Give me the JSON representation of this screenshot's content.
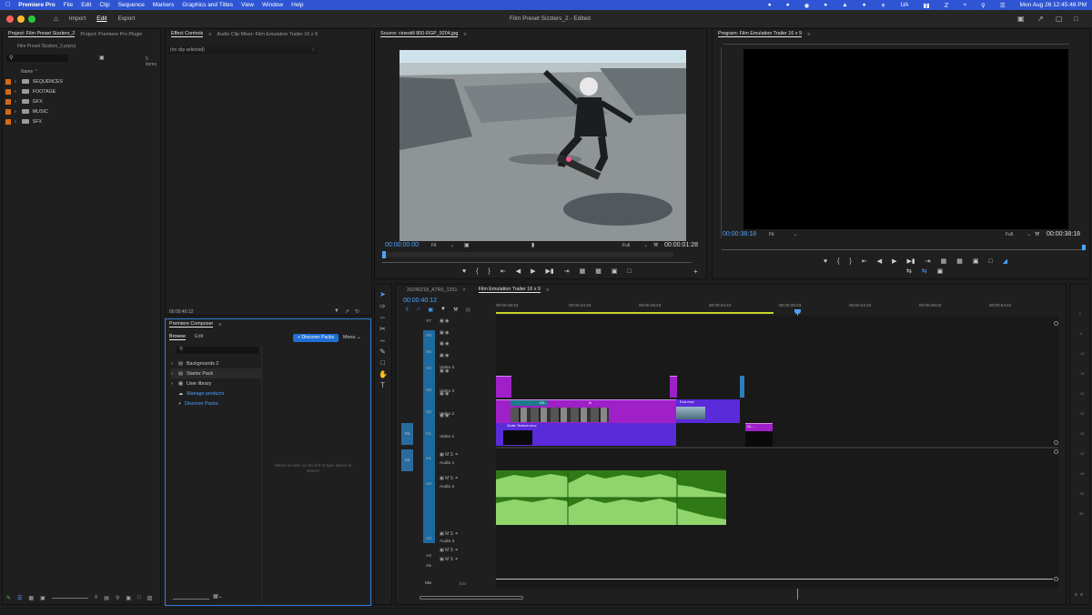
{
  "menubar": {
    "app": "Premiere Pro",
    "items": [
      "File",
      "Edit",
      "Clip",
      "Sequence",
      "Markers",
      "Graphics and Titles",
      "View",
      "Window",
      "Help"
    ],
    "lang": "UA",
    "datetime": "Mon Aug 26  12:45:48 PM"
  },
  "titlebar": {
    "workspaces": [
      "Import",
      "Edit",
      "Export"
    ],
    "active_workspace": "Edit",
    "document_title": "Film Preset Sizzlers_2 - Edited"
  },
  "project": {
    "tab": "Project: Film Preset Sizzlers_2",
    "tab2": "Project: Premiere Pro Plugin",
    "file": "Film Preset Sizzlers_2.prproj",
    "count": "5 items",
    "col_name": "Name",
    "folders": [
      "SEQUENCES",
      "FOOTAGE",
      "GFX",
      "MUSIC",
      "SFX"
    ]
  },
  "effect_controls": {
    "tab": "Effect Controls",
    "tab2": "Audio Clip Mixer: Film Emulation Trailer 16 x 9",
    "no_clip": "(no clip selected)",
    "timecode": "00:00:40:12"
  },
  "source": {
    "tab": "Source: cinestill 800-RGP_9204.jpg",
    "timecode_in": "00:00:00:00",
    "fit": "Fit",
    "quality": "Full",
    "timecode_out": "00:00:01:28"
  },
  "program": {
    "tab": "Program: Film Emulation Trailer 16 x 9",
    "timecode": "00:00:38:18",
    "fit": "Fit",
    "quality": "Full",
    "duration": "00:00:38:18"
  },
  "composer": {
    "title": "Premiere Composer",
    "tabs": [
      "Browse",
      "Edit"
    ],
    "discover_button": "+ Discover Packs",
    "menu": "Menu",
    "items": [
      "Backgrounds 2",
      "Starter Pack",
      "User library"
    ],
    "links": [
      "Manage products",
      "Discover Packs"
    ],
    "hint": "Select an item on the left or type above to search"
  },
  "timeline": {
    "tabs": [
      "20240218_A7R5_1251",
      "Film Emulation Trailer 16 x 9"
    ],
    "timecode": "00:00:40:12",
    "ruler": [
      "00:00:19:23",
      "00:00:24:23",
      "00:00:29:23",
      "00:00:34:23",
      "00:00:39:23",
      "00:00:44:22",
      "00:00:49:22",
      "00:00:54:22"
    ],
    "video_tracks": [
      "V7",
      "V6",
      "V5",
      "V4",
      "V3",
      "V2",
      "V1"
    ],
    "video_names": [
      "Video 4",
      "Video 3",
      "Video 2",
      "Video 1"
    ],
    "audio_tracks": [
      "A1",
      "A2",
      "A3",
      "A4",
      "A5"
    ],
    "audio_names": [
      "Audio 1",
      "Audio 2",
      "Audio 3"
    ],
    "mix": "Mix",
    "mix_value": "0.0",
    "clips": {
      "grain": "Grain Texture.mov",
      "end": "End.mov",
      "short": "Gr...",
      "clip_a": "fx",
      "clip_b": "LB..."
    }
  },
  "meter_ticks": [
    "0",
    "-6",
    "-12",
    "-18",
    "-24",
    "-30",
    "-36",
    "-42",
    "-48",
    "-54",
    "dB"
  ]
}
